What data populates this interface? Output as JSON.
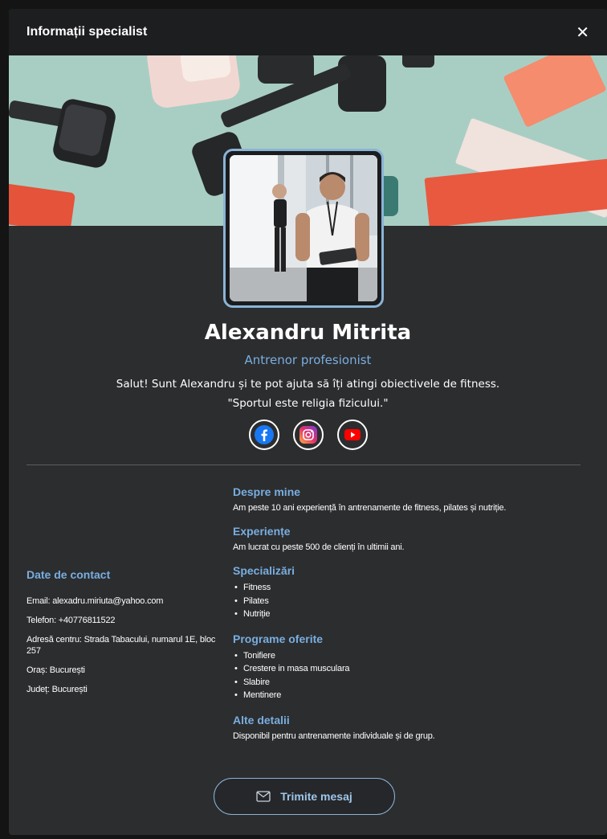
{
  "modal": {
    "title": "Informații specialist",
    "close_icon": "close-icon"
  },
  "profile": {
    "name": "Alexandru Mitrita",
    "role": "Antrenor profesionist",
    "bio": "Salut! Sunt Alexandru și te pot ajuta să îți atingi obiectivele de fitness.",
    "quote": "\"Sportul este religia fizicului.\""
  },
  "socials": [
    {
      "icon": "facebook-icon",
      "color": "#1877f2"
    },
    {
      "icon": "instagram-icon",
      "color": "#d6249f"
    },
    {
      "icon": "youtube-icon",
      "color": "#ff0000"
    }
  ],
  "contact": {
    "title": "Date de contact",
    "email": "Email: alexadru.miriuta@yahoo.com",
    "phone": "Telefon: +40776811522",
    "address": "Adresă centru: Strada Tabacului, numarul 1E, bloc 257",
    "city": "Oraș: București",
    "county": "Județ: București"
  },
  "details": {
    "about_title": "Despre mine",
    "about_text": "Am peste 10 ani experiență în antrenamente de fitness, pilates și nutriție.",
    "experience_title": "Experiențe",
    "experience_text": "Am lucrat cu peste 500 de clienți în ultimii ani.",
    "specializations_title": "Specializări",
    "specializations": [
      "Fitness",
      "Pilates",
      "Nutriție"
    ],
    "programs_title": "Programe oferite",
    "programs": [
      "Tonifiere",
      "Crestere in masa musculara",
      "Slabire",
      "Mentinere"
    ],
    "other_title": "Alte detalii",
    "other_text": "Disponibil pentru antrenamente individuale și de grup."
  },
  "actions": {
    "send_label": "Trimite mesaj",
    "send_icon": "envelope-icon"
  },
  "colors": {
    "accent": "#79aee0",
    "panel": "#2c2d2f",
    "header": "#1d1e20"
  }
}
